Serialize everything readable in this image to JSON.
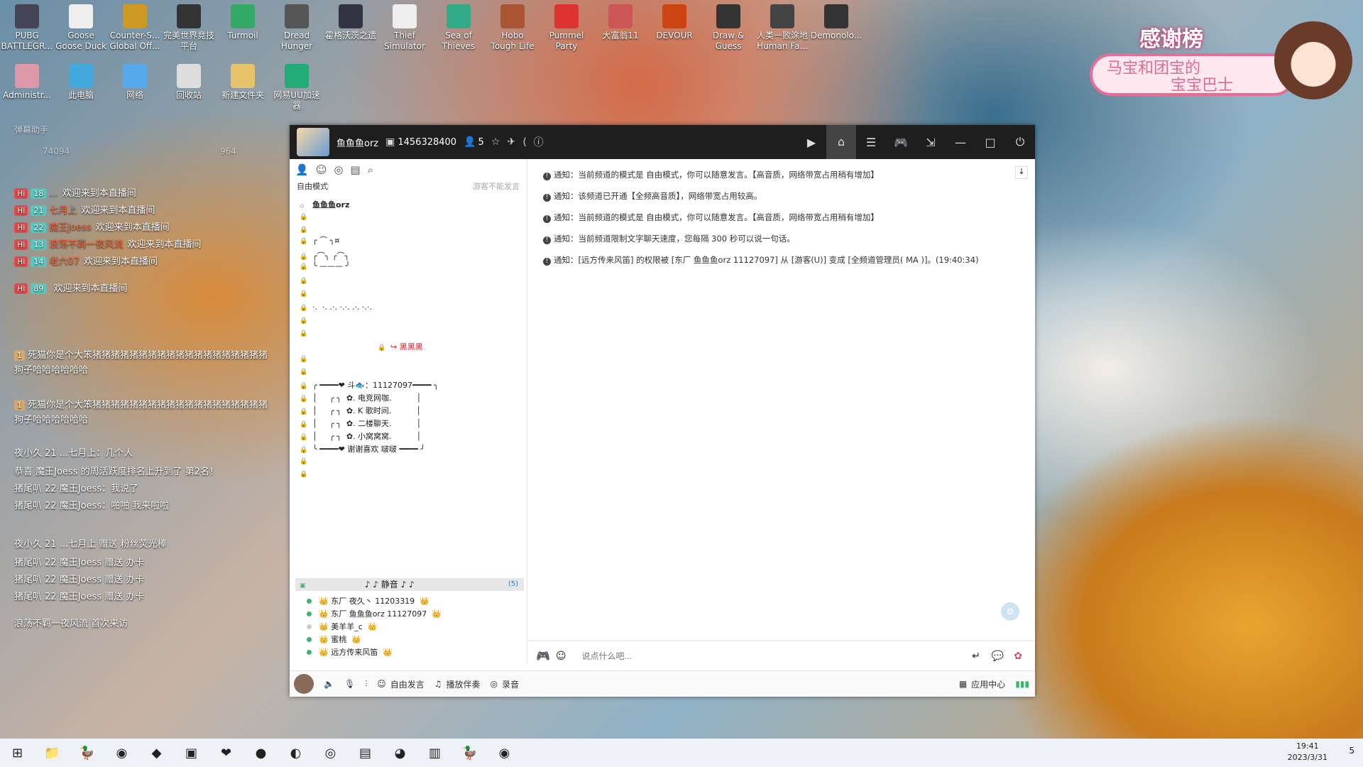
{
  "desktop_icons": [
    {
      "label": "PUBG\nBATTLEGR...",
      "x": 0,
      "y": 0
    },
    {
      "label": "Goose\nGoose Duck"
    },
    {
      "label": "Counter-S...\nGlobal Off..."
    },
    {
      "label": "完美世界竞技\n平台"
    },
    {
      "label": "Turmoil"
    },
    {
      "label": "Dread\nHunger"
    },
    {
      "label": "霍格沃茨之遗"
    },
    {
      "label": "Thief\nSimulator"
    },
    {
      "label": "Sea of\nThieves"
    },
    {
      "label": "Hobo\nTough Life"
    },
    {
      "label": "Pummel\nParty"
    },
    {
      "label": "大富翁11"
    },
    {
      "label": "DEVOUR"
    },
    {
      "label": "Draw &\nGuess"
    },
    {
      "label": "人类一败涂地\nHuman Fa..."
    },
    {
      "label": "Demonolo..."
    },
    {
      "label": "Administr..."
    },
    {
      "label": "此电脑"
    },
    {
      "label": "网络"
    },
    {
      "label": "回收站"
    },
    {
      "label": "新建文件夹"
    },
    {
      "label": "网易UU加速\n器"
    }
  ],
  "thanks_board": {
    "title": "感谢榜",
    "text1": "马宝和团宝的",
    "text2": "宝宝巴士"
  },
  "danmu": {
    "header": "弹幕助手",
    "stat1": "74094",
    "stat2": "964",
    "msgs": [
      {
        "name": "...",
        "text": "欢迎来到本直播间",
        "lvl": "18"
      },
      {
        "name": "七月上",
        "text": "欢迎来到本直播间",
        "lvl": "21"
      },
      {
        "name": "魔王Joess",
        "text": "欢迎来到本直播间",
        "lvl": "22"
      },
      {
        "name": "浪荡不羁一夜风流",
        "text": "欢迎来到本直播间",
        "lvl": "13"
      },
      {
        "name": "老六07",
        "text": "欢迎来到本直播间",
        "lvl": "14"
      },
      {
        "name": "",
        "text": "欢迎来到本直播间",
        "lvl": "89"
      }
    ],
    "long1": "死猫你是个大笨猪猪猪猪猪猪猪猪猪猪猪猪猪猪猪猪猪猪猪狗子哈哈哈哈哈哈",
    "long2": "死猫你是个大笨猪猪猪猪猪猪猪猪猪猪猪猪猪猪猪猪猪猪猪狗子哈哈哈哈哈哈",
    "l_chat": "夜小久 21 ...七月上：几个人",
    "congrats": "恭喜 魔王Joess 的周活跃度排名上升到了 第2名！",
    "l_zhuweier1": "猪尾叭 22 魔王Joess：我说了",
    "l_zhuweier2": "猪尾叭 22 魔王Joess：啪啪 我来啦啦",
    "gift1": "夜小久 21 ...七月上 赠送 粉丝荧光棒",
    "gift2": "猪尾叭 22 魔王Joess 赠送 办卡",
    "gift3": "猪尾叭 22 魔王Joess 赠送 办卡",
    "gift4": "猪尾叭 22 魔王Joess 赠送 办卡",
    "visit": "浪荡不羁一夜风流 首次来访"
  },
  "app": {
    "nick": "鱼鱼鱼orz",
    "id": "1456328400",
    "members": "5",
    "mode": "自由模式",
    "mode_right": "游客不能发言",
    "channel_name": "鱼鱼鱼orz",
    "ascii": [
      "╭ ⌒ ╮¤",
      "╭⌒╮ ╭⌒╮",
      "╰ ——— ╯",
      "·.  ·. .·. ·.·. .·. ·.·.",
      "↪ 黑黑黑",
      "╭ ━━━━❤ 斗🐟：11127097━━━━ ╮",
      "│     ╭ ╮  ✿. 电竞网咖.          │",
      "│     ╭ ╮  ✿. K 歌时间.          │",
      "│     ╭ ╮  ✿. 二楼聊天.          │",
      "│     ╭ ╮  ✿. 小窝窝窝.          │",
      "╰ ━━━━❤ 谢谢喜欢 啵啵 ━━━━ ╯"
    ],
    "active_channel": "♪ ♪  静音  ♪ ♪",
    "active_count": "(5)",
    "users": [
      {
        "name": "东厂 夜久丶 11203319",
        "online": true
      },
      {
        "name": "东厂 鱼鱼鱼orz 11127097",
        "online": true
      },
      {
        "name": "美羊羊_c",
        "online": false
      },
      {
        "name": "蜜桃",
        "online": true
      },
      {
        "name": "远方传来风笛",
        "online": true
      }
    ],
    "notices": [
      "通知：当前频道的模式是 自由模式，你可以随意发言。【高音质，网络带宽占用稍有增加】",
      "通知：该频道已开通【全频高音质】，网络带宽占用较高。",
      "通知：当前频道的模式是 自由模式，你可以随意发言。【高音质，网络带宽占用稍有增加】",
      "通知：当前频道限制文字聊天速度，您每隔 300 秒可以说一句话。",
      "通知：[远方传来风笛] 的权限被 [东厂 鱼鱼鱼orz 11127097] 从 [游客(U)] 变成 [全频道管理员( MA )]。(19:40:34)"
    ],
    "input_placeholder": "说点什么吧...",
    "bottom": {
      "free": "自由发言",
      "play": "播放伴奏",
      "record": "录音",
      "appcenter": "应用中心"
    }
  },
  "taskbar": {
    "time": "19:41",
    "date": "2023/3/31",
    "notif": "5"
  }
}
